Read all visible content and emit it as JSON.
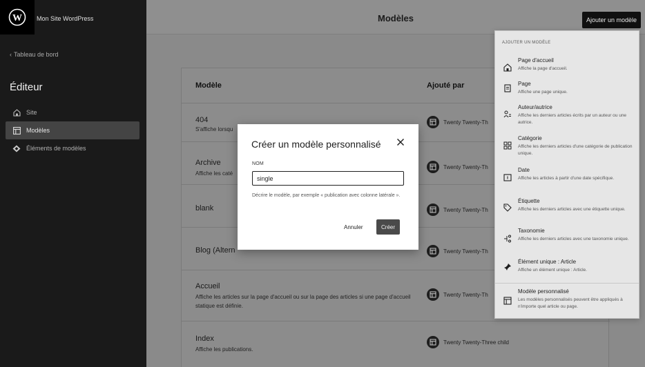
{
  "sidebar": {
    "site_name": "Mon Site WordPress",
    "back_label": "Tableau de bord",
    "editor_title": "Éditeur",
    "items": [
      {
        "label": "Site"
      },
      {
        "label": "Modèles"
      },
      {
        "label": "Éléments de modèles"
      }
    ]
  },
  "header": {
    "title": "Modèles",
    "add_button": "Ajouter un modèle"
  },
  "table": {
    "col_template": "Modèle",
    "col_added_by": "Ajouté par",
    "rows": [
      {
        "title": "404",
        "desc": "S'affiche lorsqu",
        "author": "Twenty Twenty-Th"
      },
      {
        "title": "Archive",
        "desc": "Affiche les caté",
        "author": "Twenty Twenty-Th"
      },
      {
        "title": "blank",
        "desc": "",
        "author": "Twenty Twenty-Th"
      },
      {
        "title": "Blog (Altern",
        "desc": "",
        "author": "Twenty Twenty-Th"
      },
      {
        "title": "Accueil",
        "desc": "Affiche les articles sur la page d'accueil ou sur la page des articles si une page d'accueil statique est définie.",
        "author": "Twenty Twenty-Th"
      },
      {
        "title": "Index",
        "desc": "Affiche les publications.",
        "author": "Twenty Twenty-Three child"
      }
    ]
  },
  "modal": {
    "title": "Créer un modèle personnalisé",
    "name_label": "NOM",
    "name_value": "single",
    "help": "Décrire le modèle, par exemple « publication avec colonne latérale ».",
    "cancel": "Annuler",
    "create": "Créer"
  },
  "dropdown": {
    "header": "AJOUTER UN MODÈLE",
    "items": [
      {
        "title": "Page d'accueil",
        "desc": "Affiche la page d'accueil.",
        "icon": "home-icon"
      },
      {
        "title": "Page",
        "desc": "Affiche une page unique.",
        "icon": "page-icon"
      },
      {
        "title": "Auteur/autrice",
        "desc": "Affiche les derniers articles écrits par un auteur ou une autrice.",
        "icon": "author-icon"
      },
      {
        "title": "Catégorie",
        "desc": "Affiche les derniers articles d'une catégorie de publication unique.",
        "icon": "category-icon"
      },
      {
        "title": "Date",
        "desc": "Affiche les articles à partir d'une date spécifique.",
        "icon": "calendar-icon"
      },
      {
        "title": "Étiquette",
        "desc": "Affiche les derniers articles avec une étiquette unique.",
        "icon": "tag-icon"
      },
      {
        "title": "Taxonomie",
        "desc": "Affiche les derniers articles avec une taxonomie unique.",
        "icon": "taxonomy-icon"
      },
      {
        "title": "Élément unique : Article",
        "desc": "Affiche un élément unique : Article.",
        "icon": "pin-icon"
      },
      {
        "title": "Modèle personnalisé",
        "desc": "Les modèles personnalisés peuvent être appliqués à n'importe quel article ou page.",
        "icon": "layout-icon"
      }
    ]
  }
}
